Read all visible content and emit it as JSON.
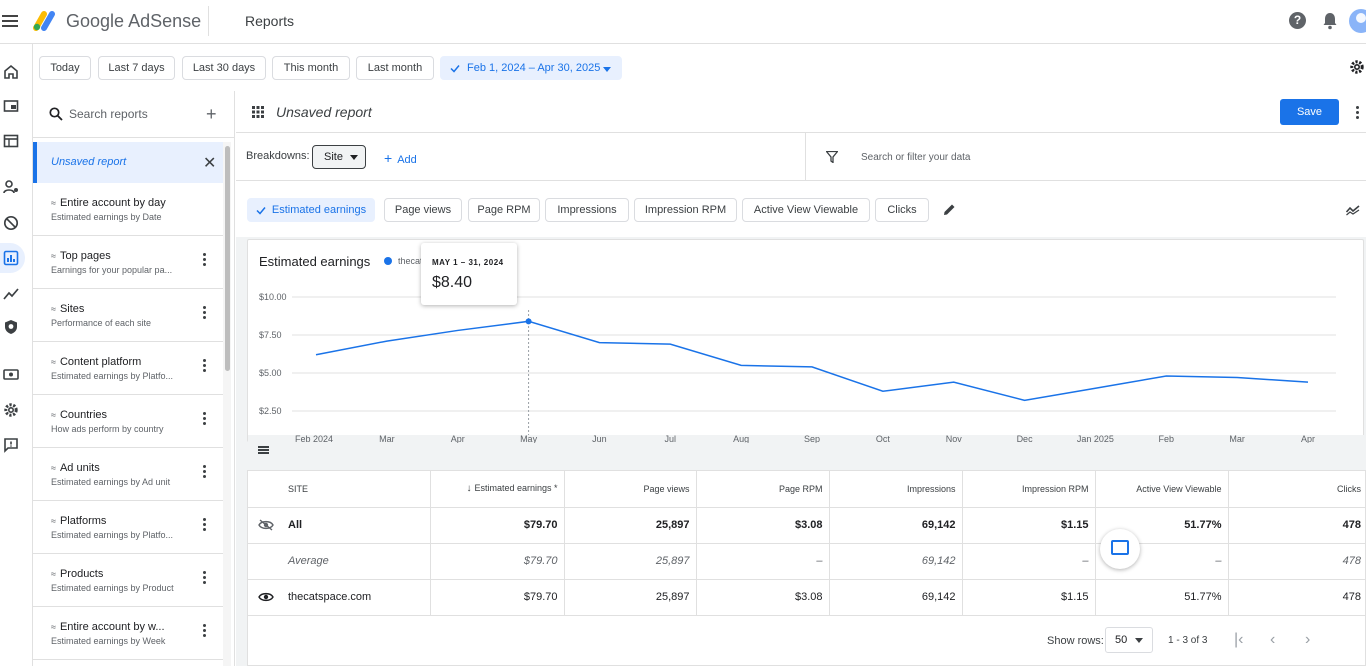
{
  "header": {
    "brand_google": "Google",
    "brand_product": "AdSense",
    "page_title": "Reports",
    "help_glyph": "?"
  },
  "rail": [
    "home-icon",
    "ads-icon",
    "sites-icon",
    "account-icon",
    "block-icon",
    "reports-icon",
    "optimization-icon",
    "privacy-icon",
    "payments-icon",
    "settings-icon",
    "feedback-icon"
  ],
  "date_ranges": {
    "today": "Today",
    "last7": "Last 7 days",
    "last30": "Last 30 days",
    "this_month": "This month",
    "last_month": "Last month",
    "custom": "Feb 1, 2024 – Apr 30, 2025"
  },
  "reports_panel": {
    "search_placeholder": "Search reports",
    "active_report": "Unsaved report",
    "items": [
      {
        "title": "Entire account by day",
        "subtitle": "Estimated earnings by Date"
      },
      {
        "title": "Top pages",
        "subtitle": "Earnings for your popular pa..."
      },
      {
        "title": "Sites",
        "subtitle": "Performance of each site"
      },
      {
        "title": "Content platform",
        "subtitle": "Estimated earnings by Platfo..."
      },
      {
        "title": "Countries",
        "subtitle": "How ads perform by country"
      },
      {
        "title": "Ad units",
        "subtitle": "Estimated earnings by Ad unit"
      },
      {
        "title": "Platforms",
        "subtitle": "Estimated earnings by Platfo..."
      },
      {
        "title": "Products",
        "subtitle": "Estimated earnings by Product"
      },
      {
        "title": "Entire account by w...",
        "subtitle": "Estimated earnings by Week"
      }
    ]
  },
  "report": {
    "title": "Unsaved report",
    "save_label": "Save",
    "breakdowns_label": "Breakdowns:",
    "breakdown_value": "Site",
    "add_label": "Add",
    "filter_placeholder": "Search or filter your data"
  },
  "metrics": [
    "Estimated earnings",
    "Page views",
    "Page RPM",
    "Impressions",
    "Impression RPM",
    "Active View Viewable",
    "Clicks"
  ],
  "chart_data": {
    "type": "line",
    "title": "Estimated earnings",
    "series": [
      {
        "name": "thecatspace.com",
        "values": [
          6.2,
          7.1,
          7.8,
          8.4,
          7.0,
          6.9,
          5.5,
          5.4,
          3.8,
          4.4,
          3.2,
          4.0,
          4.8,
          4.7,
          4.4
        ]
      }
    ],
    "x": [
      "Feb 2024",
      "Mar",
      "Apr",
      "May",
      "Jun",
      "Jul",
      "Aug",
      "Sep",
      "Oct",
      "Nov",
      "Dec",
      "Jan 2025",
      "Feb",
      "Mar",
      "Apr"
    ],
    "y_ticks": [
      "$10.00",
      "$7.50",
      "$5.00",
      "$2.50"
    ],
    "ylim": [
      0,
      10
    ],
    "grid": true,
    "tooltip": {
      "date": "MAY 1 – 31, 2024",
      "value": "$8.40"
    },
    "color": "#1a73e8"
  },
  "table": {
    "headers": [
      "SITE",
      "Estimated earnings *",
      "Page views",
      "Page RPM",
      "Impressions",
      "Impression RPM",
      "Active View Viewable",
      "Clicks"
    ],
    "rows": [
      {
        "site": "All",
        "cells": [
          "$79.70",
          "25,897",
          "$3.08",
          "69,142",
          "$1.15",
          "51.77%",
          "478"
        ]
      },
      {
        "site": "Average",
        "cells": [
          "$79.70",
          "25,897",
          "–",
          "69,142",
          "–",
          "–",
          "478"
        ]
      },
      {
        "site": "thecatspace.com",
        "cells": [
          "$79.70",
          "25,897",
          "$3.08",
          "69,142",
          "$1.15",
          "51.77%",
          "478"
        ]
      }
    ]
  },
  "pagination": {
    "rows_label": "Show rows:",
    "rows_value": "50",
    "range": "1 - 3 of 3"
  }
}
